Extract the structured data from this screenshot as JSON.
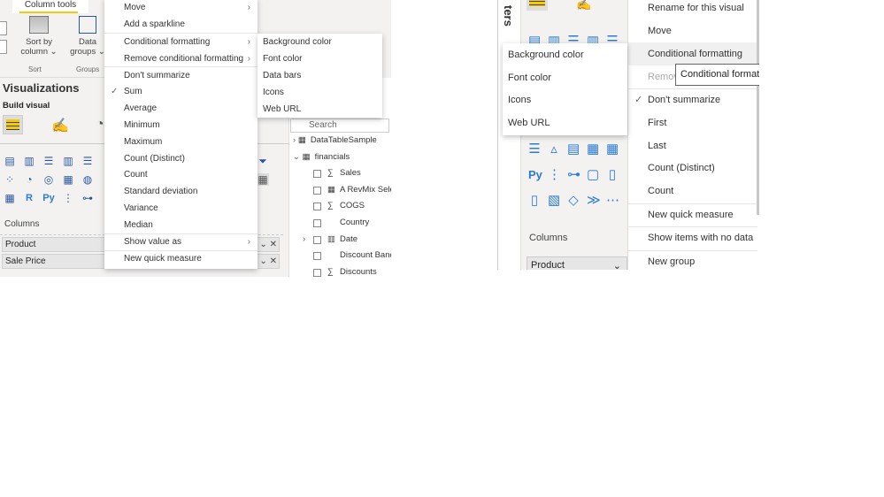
{
  "left": {
    "ribbon": {
      "tab": "Column tools",
      "sort_by": "Sort by",
      "sort_by2": "column",
      "sort_group": "Sort",
      "data_groups": "Data",
      "data_groups2": "groups",
      "groups_group": "Groups"
    },
    "viz_title": "Visualizations",
    "build_visual": "Build visual",
    "columns_label": "Columns",
    "column_fields": [
      "Product",
      "Sale Price"
    ],
    "fields_search": "Search",
    "fields": [
      {
        "label": "DataTableSample",
        "type": "table"
      },
      {
        "label": "financials",
        "type": "table"
      },
      {
        "label": "Sales",
        "type": "sum"
      },
      {
        "label": "A RevMix Sele",
        "type": "measure"
      },
      {
        "label": "COGS",
        "type": "sum"
      },
      {
        "label": "Country",
        "type": "text"
      },
      {
        "label": "Date",
        "type": "date"
      },
      {
        "label": "Discount Banc",
        "type": "text"
      },
      {
        "label": "Discounts",
        "type": "sum"
      }
    ],
    "menu": [
      "Move",
      "Add a sparkline",
      "Conditional formatting",
      "Remove conditional formatting",
      "Don't summarize",
      "Sum",
      "Average",
      "Minimum",
      "Maximum",
      "Count (Distinct)",
      "Count",
      "Standard deviation",
      "Variance",
      "Median",
      "Show value as",
      "New quick measure"
    ],
    "checked": "Sum",
    "submenu": [
      "Background color",
      "Font color",
      "Data bars",
      "Icons",
      "Web URL"
    ]
  },
  "right": {
    "filters_tab": "ters",
    "columns_label": "Columns",
    "column_field": "Product",
    "menu": [
      "Rename for this visual",
      "Move",
      "Conditional formatting",
      "Remove",
      "Don't summarize",
      "First",
      "Last",
      "Count (Distinct)",
      "Count",
      "New quick measure",
      "Show items with no data",
      "New group"
    ],
    "checked": "Don't summarize",
    "tooltip": "Conditional formatting",
    "submenu": [
      "Background color",
      "Font color",
      "Icons",
      "Web URL"
    ]
  },
  "colors": {
    "accent": "#f2c811",
    "icon_blue": "#2b579a",
    "panel": "#f3f2f1"
  }
}
